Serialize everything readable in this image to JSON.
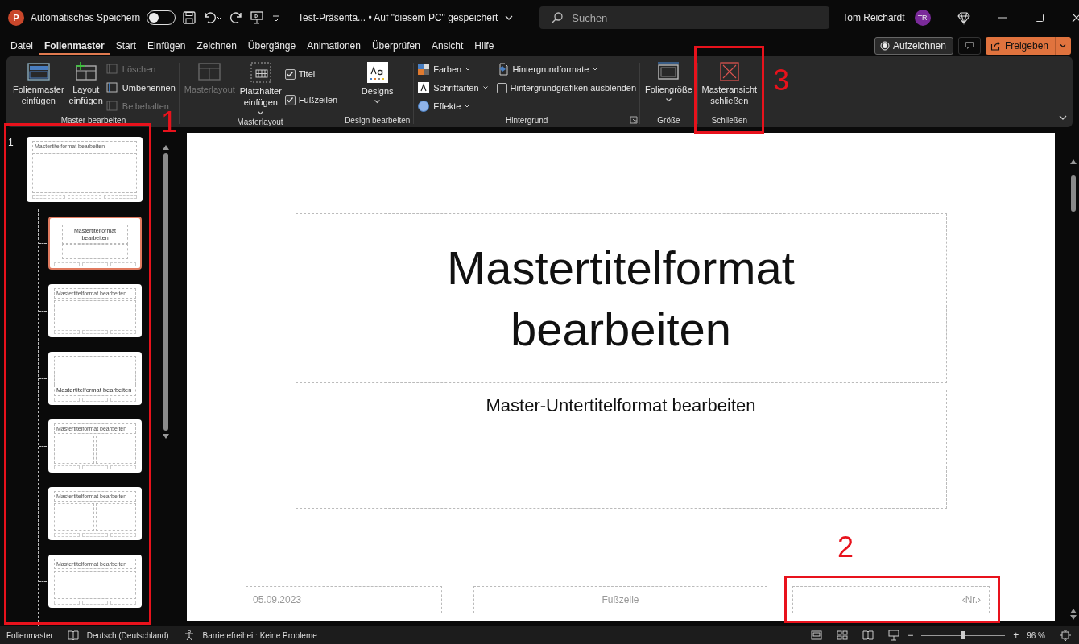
{
  "titlebar": {
    "logo_letter": "P",
    "autosave_label": "Automatisches Speichern",
    "autosave_on": false,
    "doc_title": "Test-Präsenta... • Auf \"diesem PC\" gespeichert",
    "search_placeholder": "Suchen",
    "user_name": "Tom Reichardt",
    "user_initials": "TR"
  },
  "menu_tabs": [
    {
      "label": "Datei",
      "selected": false
    },
    {
      "label": "Folienmaster",
      "selected": true
    },
    {
      "label": "Start",
      "selected": false
    },
    {
      "label": "Einfügen",
      "selected": false
    },
    {
      "label": "Zeichnen",
      "selected": false
    },
    {
      "label": "Übergänge",
      "selected": false
    },
    {
      "label": "Animationen",
      "selected": false
    },
    {
      "label": "Überprüfen",
      "selected": false
    },
    {
      "label": "Ansicht",
      "selected": false
    },
    {
      "label": "Hilfe",
      "selected": false
    }
  ],
  "record_button": "Aufzeichnen",
  "share_button": "Freigeben",
  "ribbon": {
    "master_group": "Master bearbeiten",
    "insert_master": "Folienmaster\neinfügen",
    "insert_layout": "Layout\neinfügen",
    "small_items": [
      {
        "label": "Löschen",
        "disabled": true
      },
      {
        "label": "Umbenennen",
        "disabled": false
      },
      {
        "label": "Beibehalten",
        "disabled": true
      }
    ],
    "layout_group": "Masterlayout",
    "master_layout": {
      "label": "Masterlayout",
      "disabled": true
    },
    "placeholder": "Platzhalter\neinfügen",
    "checks": [
      {
        "label": "Titel",
        "checked": true
      },
      {
        "label": "Fußzeilen",
        "checked": true
      }
    ],
    "design_group": "Design bearbeiten",
    "designs": "Designs",
    "background_group": "Hintergrund",
    "colors": "Farben",
    "fonts": "Schriftarten",
    "effects": "Effekte",
    "bg_formats": "Hintergrundformate",
    "hide_graphics": {
      "label": "Hintergrundgrafiken ausblenden",
      "checked": false
    },
    "size_group": "Größe",
    "slide_size": "Foliengröße",
    "close_group": "Schließen",
    "close_master": "Masteransicht\nschließen"
  },
  "slide_number": "1",
  "thumbnails": [
    {
      "kind": "master",
      "title": "Mastertitelformat bearbeiten",
      "selected": false
    },
    {
      "kind": "title",
      "title": "Mastertitelformat\nbearbeiten",
      "selected": true
    },
    {
      "kind": "content",
      "title": "Mastertitelformat bearbeiten",
      "selected": false
    },
    {
      "kind": "section",
      "title": "Mastertitelformat bearbeiten",
      "selected": false
    },
    {
      "kind": "two",
      "title": "Mastertitelformat bearbeiten",
      "selected": false
    },
    {
      "kind": "two",
      "title": "Mastertitelformat bearbeiten",
      "selected": false
    },
    {
      "kind": "title_only",
      "title": "Mastertitelformat bearbeiten",
      "selected": false
    }
  ],
  "slide": {
    "title": "Mastertitelformat\nbearbeiten",
    "subtitle": "Master-Untertitelformat bearbeiten",
    "date": "05.09.2023",
    "footer": "Fußzeile",
    "number": "‹Nr.›"
  },
  "status_bar": {
    "view": "Folienmaster",
    "language": "Deutsch (Deutschland)",
    "accessibility": "Barrierefreiheit: Keine Probleme",
    "zoom_minus": "−",
    "zoom_plus": "+",
    "zoom": "96 %",
    "level": 0.5
  },
  "annotations": [
    {
      "label": "1"
    },
    {
      "label": "2"
    },
    {
      "label": "3"
    }
  ]
}
